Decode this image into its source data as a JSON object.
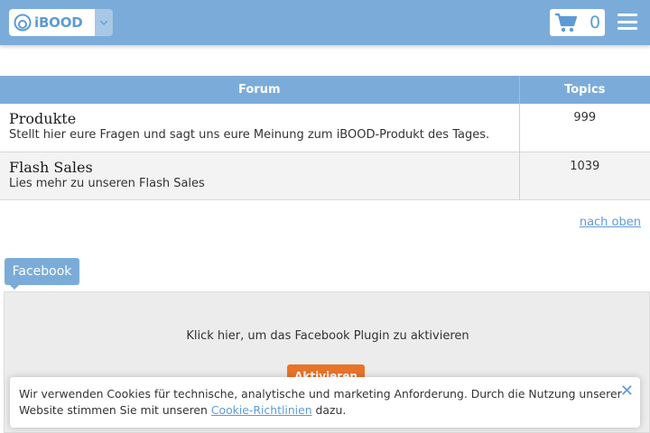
{
  "header": {
    "logo_text": "iBOOD",
    "cart_count": "0",
    "colors": {
      "bar": "#7bacd9",
      "accent": "#5d9bd5"
    },
    "icons": [
      "ibood-logo-icon",
      "chevron-down-icon",
      "shopping-cart-icon",
      "hamburger-menu-icon"
    ]
  },
  "forum_table": {
    "col_forum": "Forum",
    "col_topics": "Topics",
    "rows": [
      {
        "name": "Produkte",
        "description": "Stellt hier eure Fragen und sagt uns eure Meinung zum iBOOD-Produkt des Tages.",
        "topics": "999"
      },
      {
        "name": "Flash Sales",
        "description": "Lies mehr zu unseren Flash Sales",
        "topics": "1039"
      }
    ]
  },
  "back_to_top": "nach oben",
  "facebook": {
    "tab_label": "Facebook",
    "activate_text": "Klick hier, um das Facebook Plugin zu aktivieren",
    "activate_button": "Aktivieren",
    "button_color": "#e8742a"
  },
  "cookie_banner": {
    "text_before": "Wir verwenden Cookies für technische, analytische und marketing Anforderung. Durch die Nutzung unserer Website stimmen Sie mit unseren ",
    "link_text": "Cookie-Richtlinien",
    "text_after": " dazu.",
    "close_glyph": "✕"
  }
}
